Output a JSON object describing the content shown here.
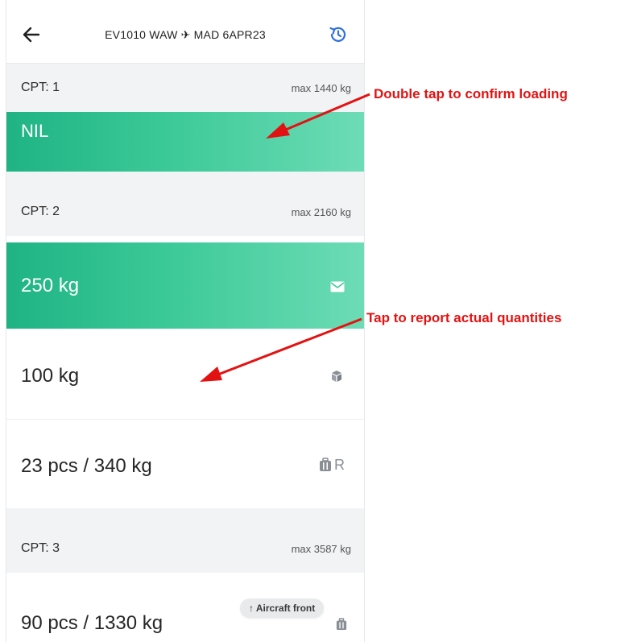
{
  "header": {
    "title": "EV1010 WAW ✈ MAD 6APR23"
  },
  "compartments": [
    {
      "label": "CPT: 1",
      "max": "max 1440 kg",
      "rows": [
        {
          "text": "NIL"
        }
      ]
    },
    {
      "label": "CPT: 2",
      "max": "max 2160 kg",
      "rows": [
        {
          "text": "250 kg"
        },
        {
          "text": "100 kg"
        },
        {
          "text": "23 pcs / 340 kg",
          "suffix": "R"
        }
      ]
    },
    {
      "label": "CPT: 3",
      "max": "max 3587 kg",
      "rows": [
        {
          "text": "90 pcs / 1330 kg"
        }
      ]
    }
  ],
  "badge": {
    "aircraft_front": "↑ Aircraft front"
  },
  "annotations": {
    "double_tap": "Double tap to confirm loading",
    "tap_report": "Tap to report actual quantities"
  },
  "colors": {
    "accent_green_start": "#1fb383",
    "accent_green_end": "#6ddcb6",
    "annotation_red": "#e31212",
    "history_blue": "#2f6fe0"
  },
  "icons": {
    "back": "arrow-left-icon",
    "history": "history-icon",
    "mail": "envelope-icon",
    "cargo": "cube-box-icon",
    "baggage": "suitcase-icon"
  }
}
